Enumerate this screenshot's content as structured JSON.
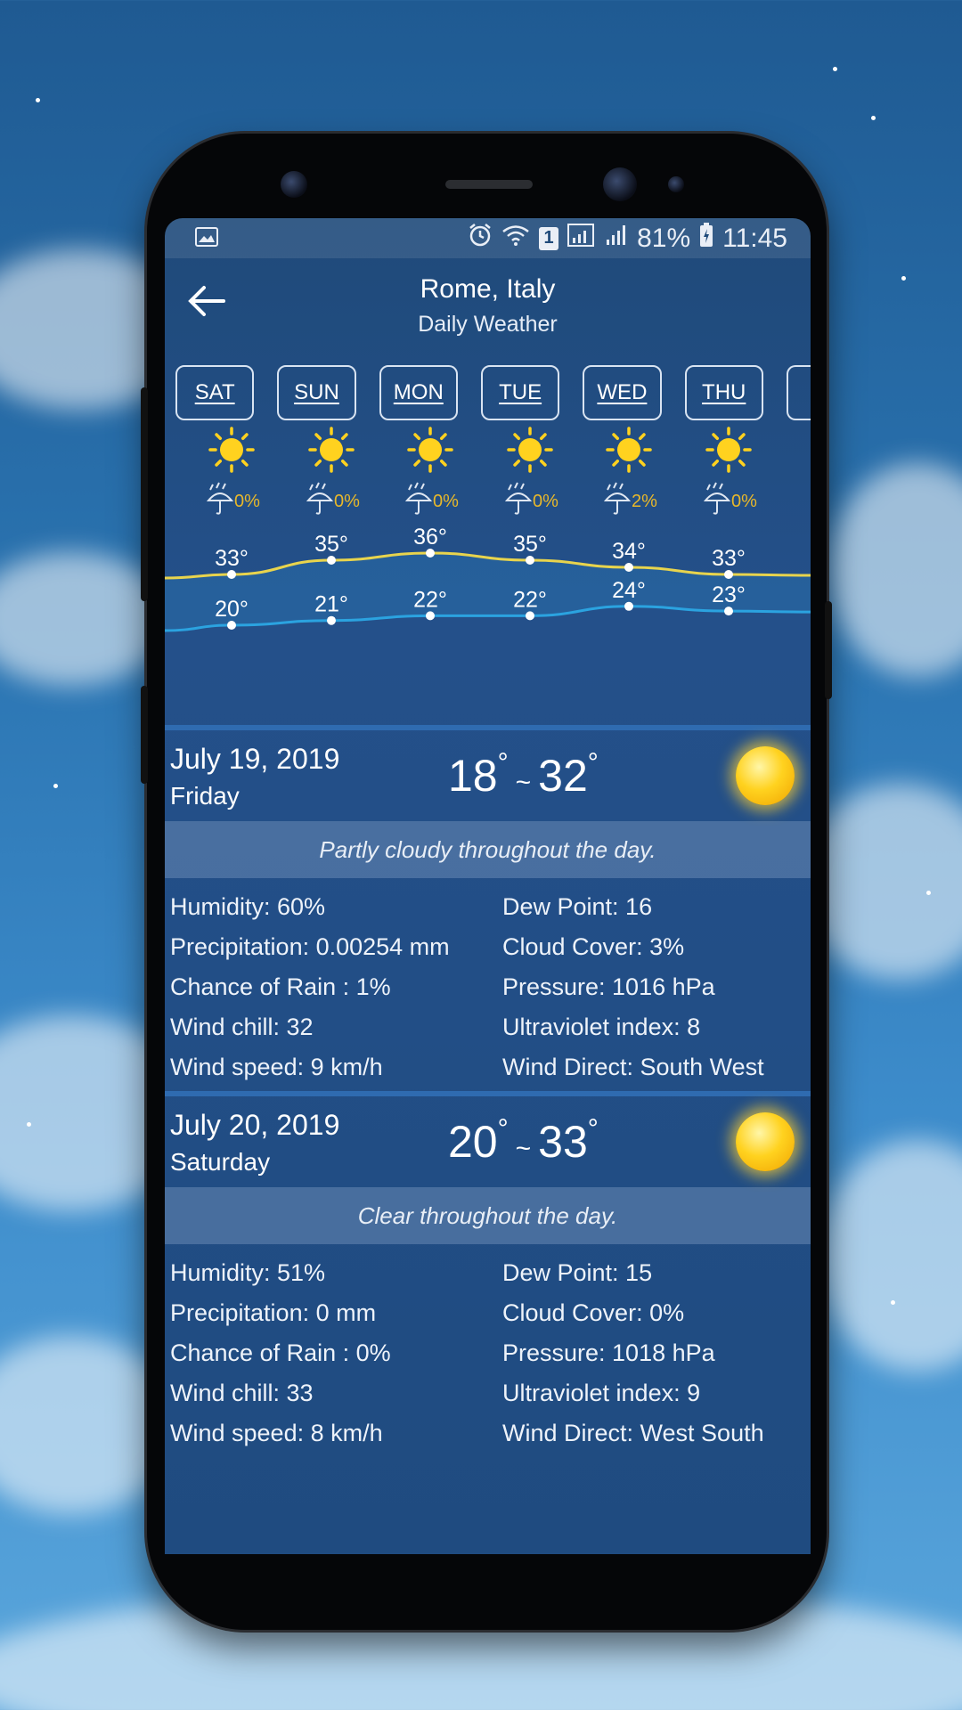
{
  "status_bar": {
    "icons": [
      "image-icon",
      "alarm-icon",
      "wifi-icon",
      "sim-1-icon",
      "signal-icon",
      "battery-icon"
    ],
    "sim_label": "1",
    "battery": "81%",
    "time": "11:45"
  },
  "header": {
    "back_icon": "arrow-left-icon",
    "city": "Rome, Italy",
    "subtitle": "Daily Weather"
  },
  "days": [
    "SAT",
    "SUN",
    "MON",
    "TUE",
    "WED",
    "THU"
  ],
  "forecast": [
    {
      "day": "SAT",
      "icon": "sun-icon",
      "rain_chance": "0%",
      "high": 33,
      "low": 20,
      "high_label": "33°",
      "low_label": "20°"
    },
    {
      "day": "SUN",
      "icon": "sun-icon",
      "rain_chance": "0%",
      "high": 35,
      "low": 21,
      "high_label": "35°",
      "low_label": "21°"
    },
    {
      "day": "MON",
      "icon": "sun-icon",
      "rain_chance": "0%",
      "high": 36,
      "low": 22,
      "high_label": "36°",
      "low_label": "22°"
    },
    {
      "day": "TUE",
      "icon": "sun-icon",
      "rain_chance": "0%",
      "high": 35,
      "low": 22,
      "high_label": "35°",
      "low_label": "22°"
    },
    {
      "day": "WED",
      "icon": "sun-icon",
      "rain_chance": "2%",
      "high": 34,
      "low": 24,
      "high_label": "34°",
      "low_label": "24°"
    },
    {
      "day": "THU",
      "icon": "sun-icon",
      "rain_chance": "0%",
      "high": 33,
      "low": 23,
      "high_label": "33°",
      "low_label": "23°"
    }
  ],
  "colors": {
    "high_line": "#e8d44d",
    "low_line": "#2ba3e0",
    "rain_text": "#e8b82a",
    "sun": "#ffd21f"
  },
  "cards": [
    {
      "date": "July 19, 2019",
      "weekday": "Friday",
      "low": "18",
      "high": "32",
      "icon": "sun-icon",
      "summary": "Partly cloudy throughout the day.",
      "left": [
        "Humidity: 60%",
        "Precipitation: 0.00254 mm",
        "Chance of Rain : 1%",
        "Wind chill: 32",
        "Wind speed: 9 km/h"
      ],
      "right": [
        "Dew Point: 16",
        "Cloud Cover: 3%",
        "Pressure: 1016 hPa",
        "Ultraviolet index: 8",
        "Wind Direct: South West"
      ]
    },
    {
      "date": "July 20, 2019",
      "weekday": "Saturday",
      "low": "20",
      "high": "33",
      "icon": "sun-icon",
      "summary": "Clear throughout the day.",
      "left": [
        "Humidity: 51%",
        "Precipitation: 0 mm",
        "Chance of Rain : 0%",
        "Wind chill: 33",
        "Wind speed: 8 km/h"
      ],
      "right": [
        "Dew Point: 15",
        "Cloud Cover: 0%",
        "Pressure: 1018 hPa",
        "Ultraviolet index: 9",
        "Wind Direct: West South"
      ]
    }
  ]
}
